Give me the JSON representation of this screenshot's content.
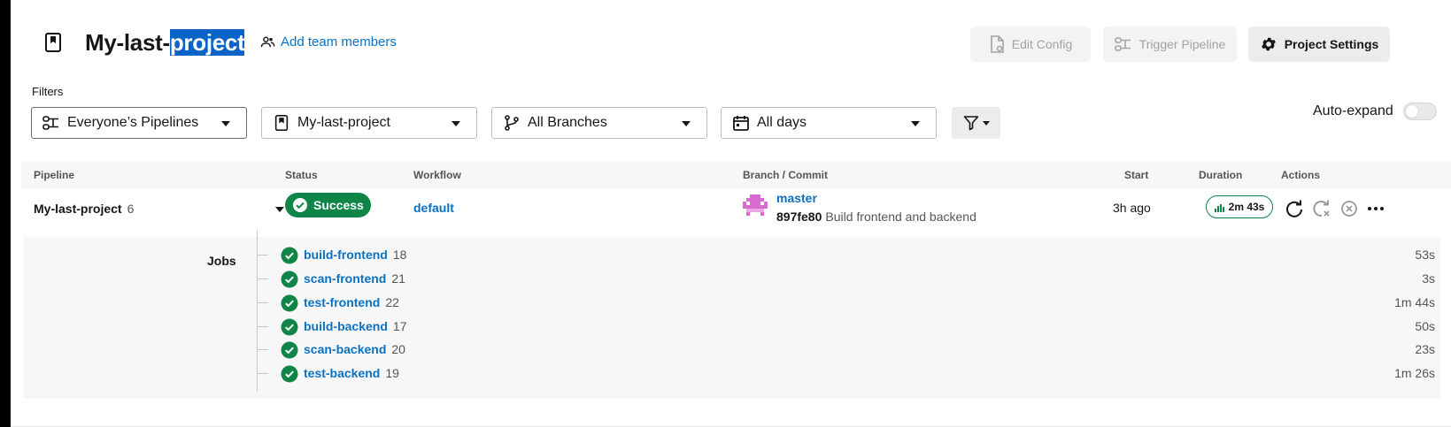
{
  "header": {
    "title_prefix": "My-last-",
    "title_selected": "project",
    "add_team_label": "Add team members",
    "edit_config_label": "Edit Config",
    "trigger_pipeline_label": "Trigger Pipeline",
    "project_settings_label": "Project Settings"
  },
  "filters": {
    "label": "Filters",
    "pipelines": "Everyone’s Pipelines",
    "project": "My-last-project",
    "branches": "All Branches",
    "days": "All days",
    "auto_expand_label": "Auto-expand",
    "auto_expand_on": false
  },
  "table": {
    "columns": {
      "pipeline": "Pipeline",
      "status": "Status",
      "workflow": "Workflow",
      "branch_commit": "Branch / Commit",
      "start": "Start",
      "duration": "Duration",
      "actions": "Actions"
    },
    "row": {
      "pipeline_name": "My-last-project",
      "pipeline_number": "6",
      "status": "Success",
      "workflow": "default",
      "branch": "master",
      "commit_sha": "897fe80",
      "commit_message": "Build frontend and backend",
      "start": "3h ago",
      "duration": "2m 43s"
    }
  },
  "jobs": {
    "label": "Jobs",
    "items": [
      {
        "name": "build-frontend",
        "number": "18",
        "duration": "53s"
      },
      {
        "name": "scan-frontend",
        "number": "21",
        "duration": "3s"
      },
      {
        "name": "test-frontend",
        "number": "22",
        "duration": "1m 44s"
      },
      {
        "name": "build-backend",
        "number": "17",
        "duration": "50s"
      },
      {
        "name": "scan-backend",
        "number": "20",
        "duration": "23s"
      },
      {
        "name": "test-backend",
        "number": "19",
        "duration": "1m 26s"
      }
    ]
  },
  "colors": {
    "success": "#108548",
    "link": "#0a71c2",
    "selection": "#0a64c8"
  },
  "icons": [
    "project-icon",
    "team-icon",
    "file-icon",
    "pipeline-icon",
    "gear-icon",
    "filter-icon",
    "branch-icon",
    "calendar-icon",
    "check-icon",
    "chart-icon",
    "rerun-icon",
    "rerun-failed-icon",
    "cancel-icon",
    "more-icon"
  ]
}
